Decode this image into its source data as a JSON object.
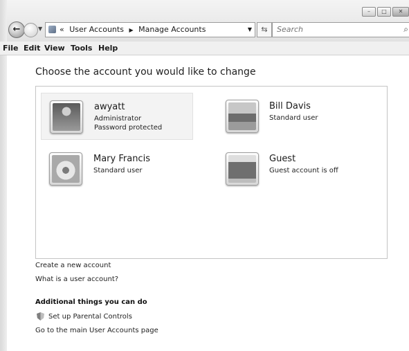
{
  "window": {
    "controls": [
      "–",
      "□",
      "✕"
    ]
  },
  "address_bar": {
    "chevron": "«",
    "crumbs": [
      "User Accounts",
      "Manage Accounts"
    ],
    "separator": "▶"
  },
  "search": {
    "placeholder": "Search"
  },
  "menu": [
    "File",
    "Edit",
    "View",
    "Tools",
    "Help"
  ],
  "main": {
    "heading": "Choose the account you would like to change",
    "accounts": [
      {
        "name": "awyatt",
        "lines": [
          "Administrator",
          "Password protected"
        ],
        "picture": "chess-pieces-picture",
        "selected": true
      },
      {
        "name": "Bill Davis",
        "lines": [
          "Standard user"
        ],
        "picture": "landscape-picture",
        "selected": false
      },
      {
        "name": "Mary Francis",
        "lines": [
          "Standard user"
        ],
        "picture": "flower-picture",
        "selected": false
      },
      {
        "name": "Guest",
        "lines": [
          "Guest account is off"
        ],
        "picture": "briefcase-picture",
        "selected": false
      }
    ],
    "links": [
      "Create a new account",
      "What is a user account?"
    ],
    "additional_title": "Additional things you can do",
    "additional_links": [
      "Set up Parental Controls",
      "Go to the main User Accounts page"
    ]
  },
  "icons": {
    "back": "back-arrow-icon",
    "forward": "forward-arrow-icon",
    "refresh": "refresh-icon",
    "search": "magnifier-icon",
    "parental": "shield-icon"
  }
}
